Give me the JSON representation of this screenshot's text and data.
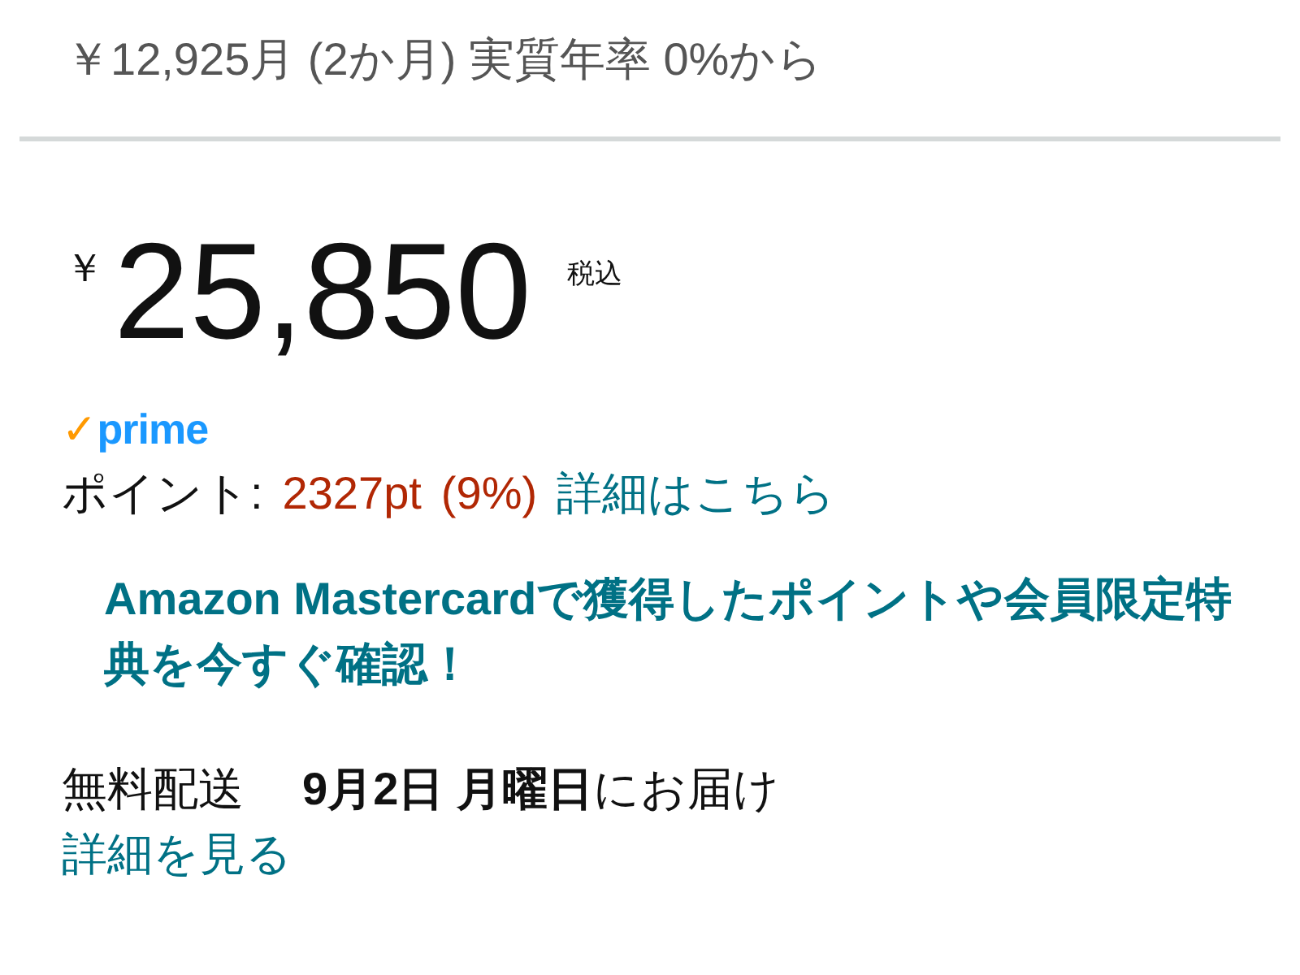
{
  "installment": "￥12,925月 (2か月) 実質年率 0%から",
  "price": {
    "currency": "￥",
    "amount": "25,850",
    "tax_note": "税込"
  },
  "prime_badge": {
    "check": "✓",
    "label": "prime"
  },
  "points": {
    "label": "ポイント:",
    "value": "2327pt",
    "percent": "(9%)",
    "link": "詳細はこちら"
  },
  "promo_link": "Amazon Mastercardで獲得したポイントや会員限定特典を今すぐ確認！",
  "delivery": {
    "label": "無料配送",
    "text": "**9月2日 月曜日**にお届け",
    "link": "詳細を見る"
  }
}
